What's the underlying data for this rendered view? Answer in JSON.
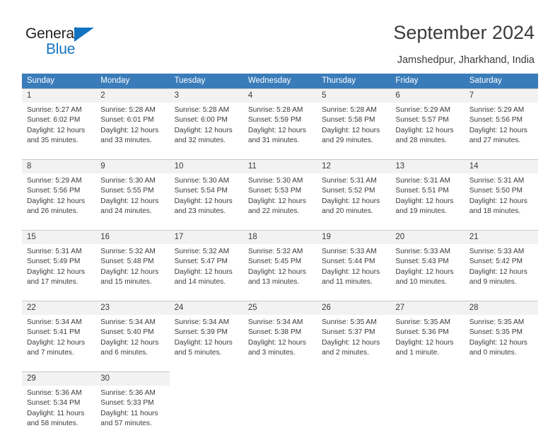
{
  "brand": {
    "name_part1": "General",
    "name_part2": "Blue",
    "accent_color": "#1273c0"
  },
  "header": {
    "title": "September 2024",
    "subtitle": "Jamshedpur, Jharkhand, India"
  },
  "calendar": {
    "header_color": "#3a7cba",
    "weekdays": [
      "Sunday",
      "Monday",
      "Tuesday",
      "Wednesday",
      "Thursday",
      "Friday",
      "Saturday"
    ],
    "weeks": [
      [
        {
          "day": "1",
          "sunrise": "Sunrise: 5:27 AM",
          "sunset": "Sunset: 6:02 PM",
          "daylight1": "Daylight: 12 hours",
          "daylight2": "and 35 minutes."
        },
        {
          "day": "2",
          "sunrise": "Sunrise: 5:28 AM",
          "sunset": "Sunset: 6:01 PM",
          "daylight1": "Daylight: 12 hours",
          "daylight2": "and 33 minutes."
        },
        {
          "day": "3",
          "sunrise": "Sunrise: 5:28 AM",
          "sunset": "Sunset: 6:00 PM",
          "daylight1": "Daylight: 12 hours",
          "daylight2": "and 32 minutes."
        },
        {
          "day": "4",
          "sunrise": "Sunrise: 5:28 AM",
          "sunset": "Sunset: 5:59 PM",
          "daylight1": "Daylight: 12 hours",
          "daylight2": "and 31 minutes."
        },
        {
          "day": "5",
          "sunrise": "Sunrise: 5:28 AM",
          "sunset": "Sunset: 5:58 PM",
          "daylight1": "Daylight: 12 hours",
          "daylight2": "and 29 minutes."
        },
        {
          "day": "6",
          "sunrise": "Sunrise: 5:29 AM",
          "sunset": "Sunset: 5:57 PM",
          "daylight1": "Daylight: 12 hours",
          "daylight2": "and 28 minutes."
        },
        {
          "day": "7",
          "sunrise": "Sunrise: 5:29 AM",
          "sunset": "Sunset: 5:56 PM",
          "daylight1": "Daylight: 12 hours",
          "daylight2": "and 27 minutes."
        }
      ],
      [
        {
          "day": "8",
          "sunrise": "Sunrise: 5:29 AM",
          "sunset": "Sunset: 5:56 PM",
          "daylight1": "Daylight: 12 hours",
          "daylight2": "and 26 minutes."
        },
        {
          "day": "9",
          "sunrise": "Sunrise: 5:30 AM",
          "sunset": "Sunset: 5:55 PM",
          "daylight1": "Daylight: 12 hours",
          "daylight2": "and 24 minutes."
        },
        {
          "day": "10",
          "sunrise": "Sunrise: 5:30 AM",
          "sunset": "Sunset: 5:54 PM",
          "daylight1": "Daylight: 12 hours",
          "daylight2": "and 23 minutes."
        },
        {
          "day": "11",
          "sunrise": "Sunrise: 5:30 AM",
          "sunset": "Sunset: 5:53 PM",
          "daylight1": "Daylight: 12 hours",
          "daylight2": "and 22 minutes."
        },
        {
          "day": "12",
          "sunrise": "Sunrise: 5:31 AM",
          "sunset": "Sunset: 5:52 PM",
          "daylight1": "Daylight: 12 hours",
          "daylight2": "and 20 minutes."
        },
        {
          "day": "13",
          "sunrise": "Sunrise: 5:31 AM",
          "sunset": "Sunset: 5:51 PM",
          "daylight1": "Daylight: 12 hours",
          "daylight2": "and 19 minutes."
        },
        {
          "day": "14",
          "sunrise": "Sunrise: 5:31 AM",
          "sunset": "Sunset: 5:50 PM",
          "daylight1": "Daylight: 12 hours",
          "daylight2": "and 18 minutes."
        }
      ],
      [
        {
          "day": "15",
          "sunrise": "Sunrise: 5:31 AM",
          "sunset": "Sunset: 5:49 PM",
          "daylight1": "Daylight: 12 hours",
          "daylight2": "and 17 minutes."
        },
        {
          "day": "16",
          "sunrise": "Sunrise: 5:32 AM",
          "sunset": "Sunset: 5:48 PM",
          "daylight1": "Daylight: 12 hours",
          "daylight2": "and 15 minutes."
        },
        {
          "day": "17",
          "sunrise": "Sunrise: 5:32 AM",
          "sunset": "Sunset: 5:47 PM",
          "daylight1": "Daylight: 12 hours",
          "daylight2": "and 14 minutes."
        },
        {
          "day": "18",
          "sunrise": "Sunrise: 5:32 AM",
          "sunset": "Sunset: 5:45 PM",
          "daylight1": "Daylight: 12 hours",
          "daylight2": "and 13 minutes."
        },
        {
          "day": "19",
          "sunrise": "Sunrise: 5:33 AM",
          "sunset": "Sunset: 5:44 PM",
          "daylight1": "Daylight: 12 hours",
          "daylight2": "and 11 minutes."
        },
        {
          "day": "20",
          "sunrise": "Sunrise: 5:33 AM",
          "sunset": "Sunset: 5:43 PM",
          "daylight1": "Daylight: 12 hours",
          "daylight2": "and 10 minutes."
        },
        {
          "day": "21",
          "sunrise": "Sunrise: 5:33 AM",
          "sunset": "Sunset: 5:42 PM",
          "daylight1": "Daylight: 12 hours",
          "daylight2": "and 9 minutes."
        }
      ],
      [
        {
          "day": "22",
          "sunrise": "Sunrise: 5:34 AM",
          "sunset": "Sunset: 5:41 PM",
          "daylight1": "Daylight: 12 hours",
          "daylight2": "and 7 minutes."
        },
        {
          "day": "23",
          "sunrise": "Sunrise: 5:34 AM",
          "sunset": "Sunset: 5:40 PM",
          "daylight1": "Daylight: 12 hours",
          "daylight2": "and 6 minutes."
        },
        {
          "day": "24",
          "sunrise": "Sunrise: 5:34 AM",
          "sunset": "Sunset: 5:39 PM",
          "daylight1": "Daylight: 12 hours",
          "daylight2": "and 5 minutes."
        },
        {
          "day": "25",
          "sunrise": "Sunrise: 5:34 AM",
          "sunset": "Sunset: 5:38 PM",
          "daylight1": "Daylight: 12 hours",
          "daylight2": "and 3 minutes."
        },
        {
          "day": "26",
          "sunrise": "Sunrise: 5:35 AM",
          "sunset": "Sunset: 5:37 PM",
          "daylight1": "Daylight: 12 hours",
          "daylight2": "and 2 minutes."
        },
        {
          "day": "27",
          "sunrise": "Sunrise: 5:35 AM",
          "sunset": "Sunset: 5:36 PM",
          "daylight1": "Daylight: 12 hours",
          "daylight2": "and 1 minute."
        },
        {
          "day": "28",
          "sunrise": "Sunrise: 5:35 AM",
          "sunset": "Sunset: 5:35 PM",
          "daylight1": "Daylight: 12 hours",
          "daylight2": "and 0 minutes."
        }
      ],
      [
        {
          "day": "29",
          "sunrise": "Sunrise: 5:36 AM",
          "sunset": "Sunset: 5:34 PM",
          "daylight1": "Daylight: 11 hours",
          "daylight2": "and 58 minutes."
        },
        {
          "day": "30",
          "sunrise": "Sunrise: 5:36 AM",
          "sunset": "Sunset: 5:33 PM",
          "daylight1": "Daylight: 11 hours",
          "daylight2": "and 57 minutes."
        },
        {
          "day": "",
          "sunrise": "",
          "sunset": "",
          "daylight1": "",
          "daylight2": ""
        },
        {
          "day": "",
          "sunrise": "",
          "sunset": "",
          "daylight1": "",
          "daylight2": ""
        },
        {
          "day": "",
          "sunrise": "",
          "sunset": "",
          "daylight1": "",
          "daylight2": ""
        },
        {
          "day": "",
          "sunrise": "",
          "sunset": "",
          "daylight1": "",
          "daylight2": ""
        },
        {
          "day": "",
          "sunrise": "",
          "sunset": "",
          "daylight1": "",
          "daylight2": ""
        }
      ]
    ]
  }
}
